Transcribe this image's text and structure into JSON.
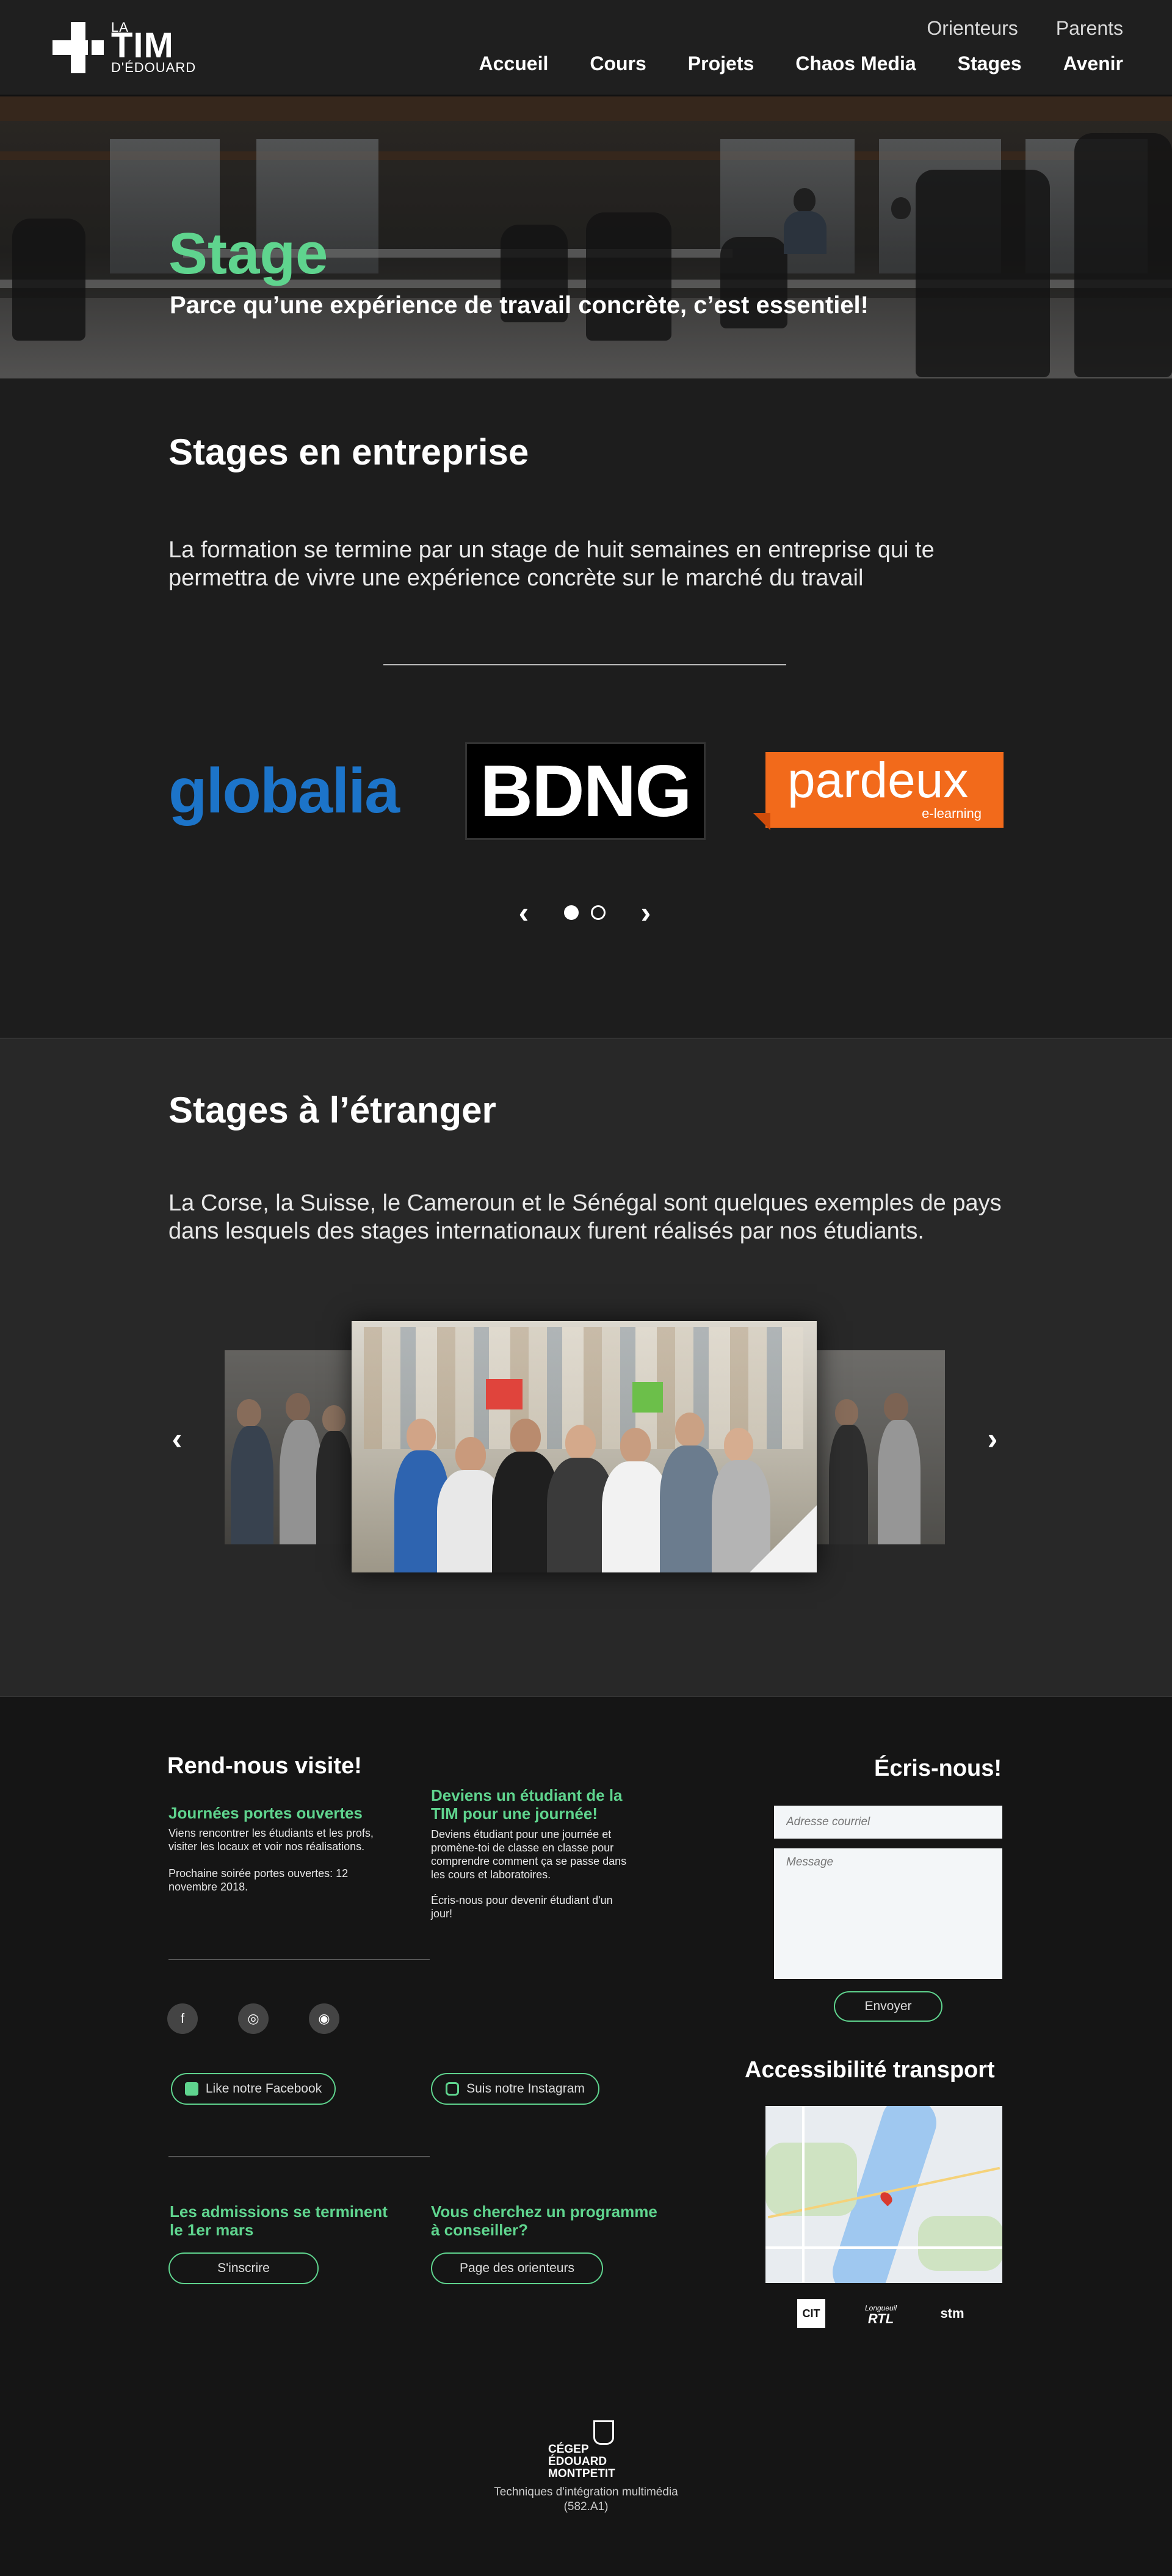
{
  "header": {
    "logo": {
      "la": "LA",
      "tim": "TIM",
      "de": "D'ÉDOUARD"
    },
    "topnav": [
      "Orienteurs",
      "Parents"
    ],
    "mainnav": [
      "Accueil",
      "Cours",
      "Projets",
      "Chaos Media",
      "Stages",
      "Avenir"
    ]
  },
  "hero": {
    "title": "Stage",
    "subtitle": "Parce qu’une expérience de travail concrète, c’est essentiel!"
  },
  "enterprise": {
    "heading": "Stages en entreprise",
    "lead": "La formation se termine par un stage de huit semaines en entreprise qui te permettra de vivre une expérience concrète sur le marché du travail",
    "partners": {
      "globalia": "globalia",
      "bdng": "BDNG",
      "pardeux": "pardeux",
      "pardeux_tag": "e-learning"
    },
    "carousel": {
      "prev": "‹",
      "next": "›",
      "pages": 2,
      "active": 1
    }
  },
  "abroad": {
    "heading": "Stages à l’étranger",
    "lead": "La Corse, la Suisse, le Cameroun et le Sénégal sont quelques exemples de pays dans lesquels des stages internationaux furent réalisés par nos étudiants.",
    "prev": "‹",
    "next": "›"
  },
  "footer": {
    "visit_heading": "Rend-nous visite!",
    "open_house_title": "Journées portes ouvertes",
    "open_house_text": "Viens rencontrer les étudiants et les profs, visiter les locaux et voir nos réalisations.",
    "open_house_date": "Prochaine soirée portes ouvertes: 12 novembre 2018.",
    "student_day_title": "Deviens un étudiant de la TIM pour une journée!",
    "student_day_text": "Deviens étudiant pour une journée et promène-toi de classe en classe pour comprendre comment ça se passe dans les cours et laboratoires.",
    "student_day_cta": "Écris-nous pour devenir étudiant d'un jour!",
    "social": {
      "facebook": "f",
      "instagram": "◎",
      "discord": "◉"
    },
    "like_facebook": "Like notre Facebook",
    "follow_instagram": "Suis notre Instagram",
    "admissions_title": "Les admissions se terminent le 1er mars",
    "admissions_button": "S'inscrire",
    "counselor_title": "Vous cherchez un programme à conseiller?",
    "counselor_button": "Page des orienteurs",
    "contact_heading": "Écris-nous!",
    "email_placeholder": "Adresse courriel",
    "message_placeholder": "Message",
    "send_button": "Envoyer",
    "transport_heading": "Accessibilité transport",
    "transit": {
      "cit": "CIT",
      "rtl": "RTL",
      "rtl_small": "Longueuil",
      "stm": "stm"
    },
    "cegep": {
      "line1": "CÉGEP",
      "line2": "ÉDOUARD",
      "line3": "MONTPETIT"
    },
    "program": "Techniques d'intégration multimédia",
    "program_code": "(582.A1)"
  },
  "colors": {
    "accent": "#5fd48e",
    "globalia": "#1c74c9",
    "pardeux": "#f26a1b"
  }
}
